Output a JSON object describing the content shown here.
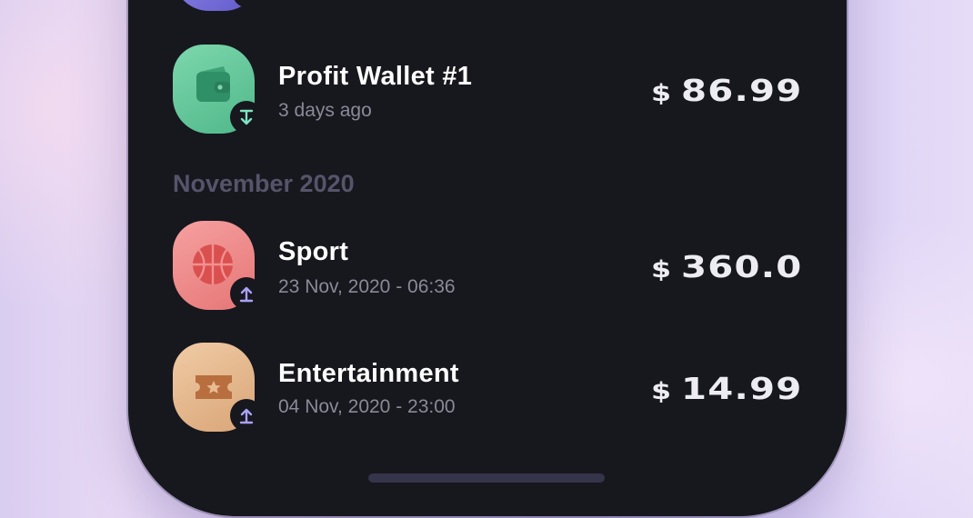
{
  "transactions_recent": [
    {
      "title": "Profit Wallet #1",
      "subtitle": "3 days ago",
      "currency": "$",
      "amount": "86.99",
      "icon": "wallet-icon",
      "direction": "incoming",
      "tile_color": "#5fc49a"
    }
  ],
  "section": {
    "label": "November 2020"
  },
  "transactions_november": [
    {
      "title": "Sport",
      "subtitle": "23 Nov, 2020 - 06:36",
      "currency": "$",
      "amount": "360.0",
      "icon": "basketball-icon",
      "direction": "outgoing",
      "tile_color": "#ee8686"
    },
    {
      "title": "Entertainment",
      "subtitle": "04 Nov, 2020 - 23:00",
      "currency": "$",
      "amount": "14.99",
      "icon": "ticket-icon",
      "direction": "outgoing",
      "tile_color": "#e7b98f"
    }
  ],
  "colors": {
    "screen_bg": "#17171e",
    "incoming_arrow": "#7ee3c0",
    "outgoing_arrow": "#a8a2f5",
    "muted_text": "#8a8a98",
    "section_text": "#55546a"
  }
}
